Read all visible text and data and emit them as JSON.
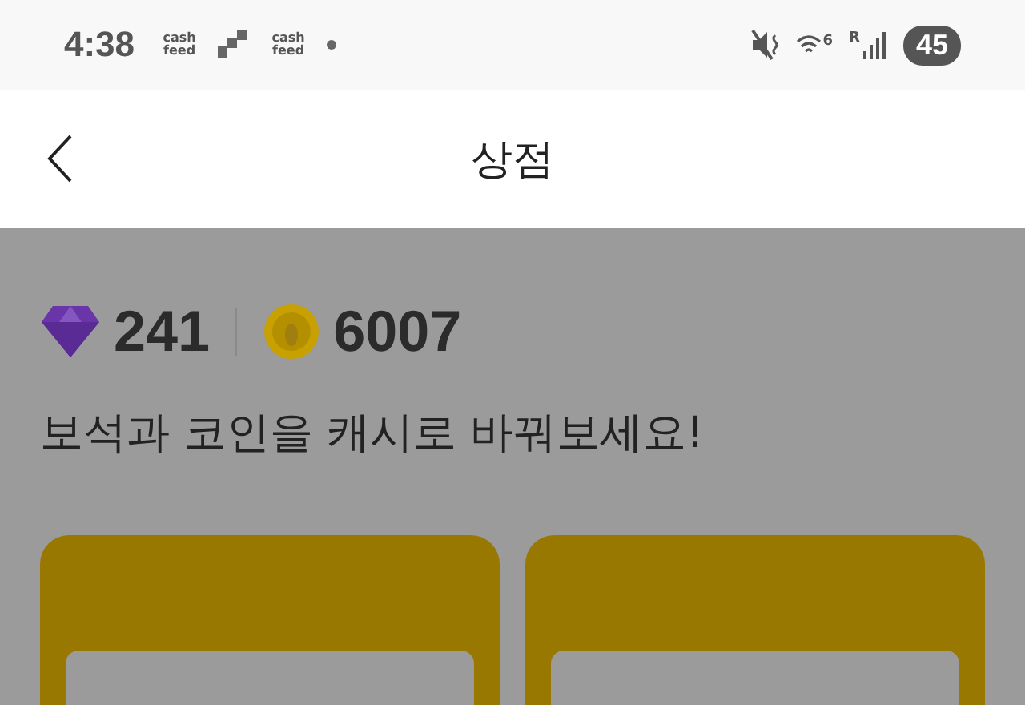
{
  "status_bar": {
    "time": "4:38",
    "notifications": [
      {
        "kind": "text",
        "label": "cash feed"
      },
      {
        "kind": "blocks"
      },
      {
        "kind": "text",
        "label": "cash feed"
      },
      {
        "kind": "dot"
      }
    ],
    "wifi_label": "6",
    "signal_label": "R",
    "battery": "45"
  },
  "header": {
    "title": "상점"
  },
  "balance": {
    "gems": "241",
    "coins": "6007"
  },
  "headline": "보석과 코인을 캐시로 바꿔보세요!"
}
